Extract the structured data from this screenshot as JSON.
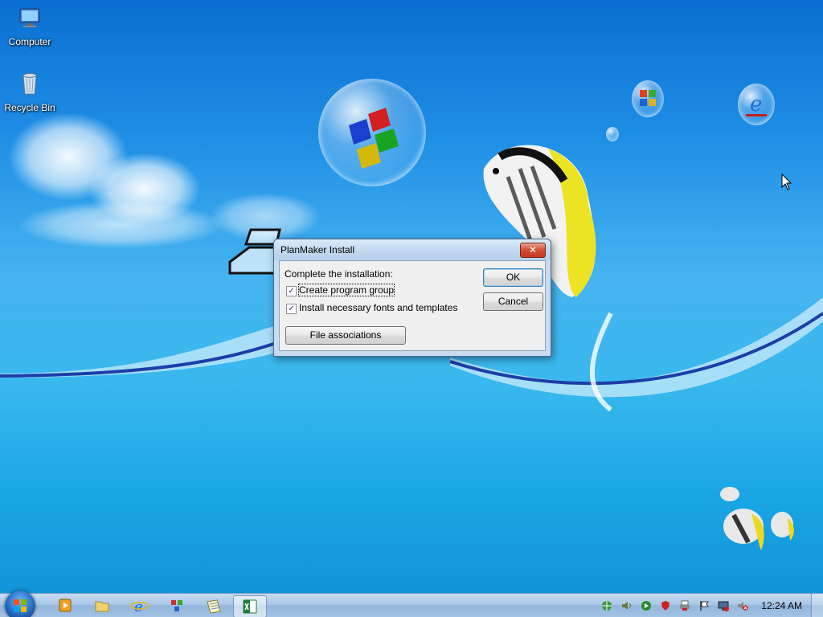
{
  "desktop": {
    "icons": [
      {
        "label": "Computer",
        "icon": "computer-icon"
      },
      {
        "label": "Recycle Bin",
        "icon": "recycle-bin-icon"
      }
    ]
  },
  "dialog": {
    "title": "PlanMaker Install",
    "close_label": "✕",
    "prompt": "Complete the installation:",
    "options": [
      {
        "label": "Create program group",
        "checked": true
      },
      {
        "label": "Install necessary fonts and templates",
        "checked": true
      }
    ],
    "file_assoc_label": "File associations",
    "ok_label": "OK",
    "cancel_label": "Cancel"
  },
  "taskbar": {
    "pinned": [
      "media-player-icon",
      "explorer-folder-icon",
      "internet-explorer-icon",
      "network-icon",
      "notepad-icon",
      "excel-icon"
    ],
    "active_index": 5,
    "tray": [
      "network-globe-icon",
      "volume-icon",
      "play-icon",
      "antivirus-icon",
      "printer-icon",
      "action-center-flag-icon",
      "display-icon",
      "speaker-muted-icon"
    ],
    "clock": "12:24 AM"
  },
  "colors": {
    "sky_top": "#0a6fd0",
    "sky_bottom": "#108fd6",
    "close_red": "#c43a20"
  }
}
